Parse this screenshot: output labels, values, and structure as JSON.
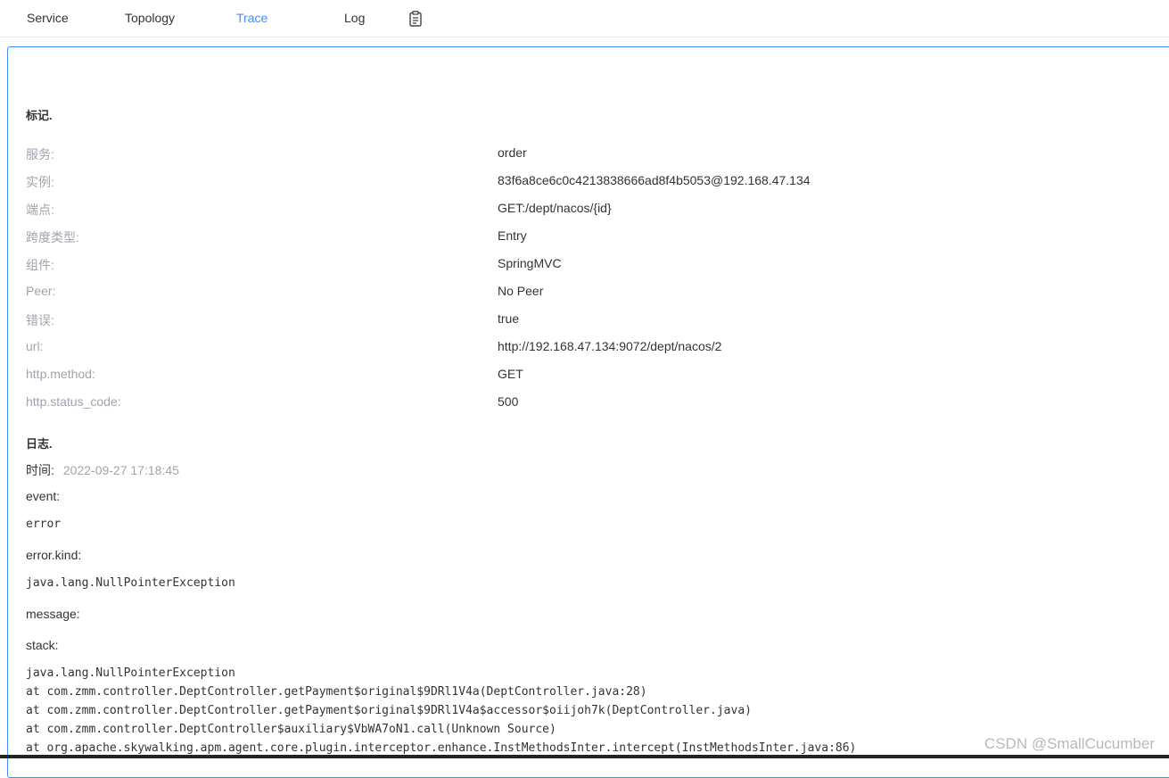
{
  "nav": {
    "tabs": [
      {
        "label": "Service"
      },
      {
        "label": "Topology"
      },
      {
        "label": "Trace"
      },
      {
        "label": "Log"
      }
    ],
    "active_tab": "Trace",
    "clipboard_icon": "clipboard-icon",
    "accent_color": "#448dfe"
  },
  "tags": {
    "title": "标记.",
    "items": [
      {
        "key": "服务:",
        "value": "order"
      },
      {
        "key": "实例:",
        "value": "83f6a8ce6c0c4213838666ad8f4b5053@192.168.47.134"
      },
      {
        "key": "端点:",
        "value": "GET:/dept/nacos/{id}"
      },
      {
        "key": "跨度类型:",
        "value": "Entry"
      },
      {
        "key": "组件:",
        "value": "SpringMVC"
      },
      {
        "key": "Peer:",
        "value": "No Peer"
      },
      {
        "key": "错误:",
        "value": "true"
      },
      {
        "key": "url:",
        "value": "http://192.168.47.134:9072/dept/nacos/2"
      },
      {
        "key": "http.method:",
        "value": "GET"
      },
      {
        "key": "http.status_code:",
        "value": "500"
      }
    ]
  },
  "logs": {
    "title": "日志.",
    "time_label": "时间:",
    "time_value": "2022-09-27 17:18:45",
    "event_label": "event:",
    "event_value": "error",
    "error_kind_label": "error.kind:",
    "error_kind_value": "java.lang.NullPointerException",
    "message_label": "message:",
    "stack_label": "stack:",
    "stack_lines": [
      "java.lang.NullPointerException",
      "at com.zmm.controller.DeptController.getPayment$original$9DRl1V4a(DeptController.java:28)",
      "at com.zmm.controller.DeptController.getPayment$original$9DRl1V4a$accessor$oiijoh7k(DeptController.java)",
      "at com.zmm.controller.DeptController$auxiliary$VbWA7oN1.call(Unknown Source)",
      "at org.apache.skywalking.apm.agent.core.plugin.interceptor.enhance.InstMethodsInter.intercept(InstMethodsInter.java:86)"
    ]
  },
  "watermark": "CSDN @SmallCucumber"
}
